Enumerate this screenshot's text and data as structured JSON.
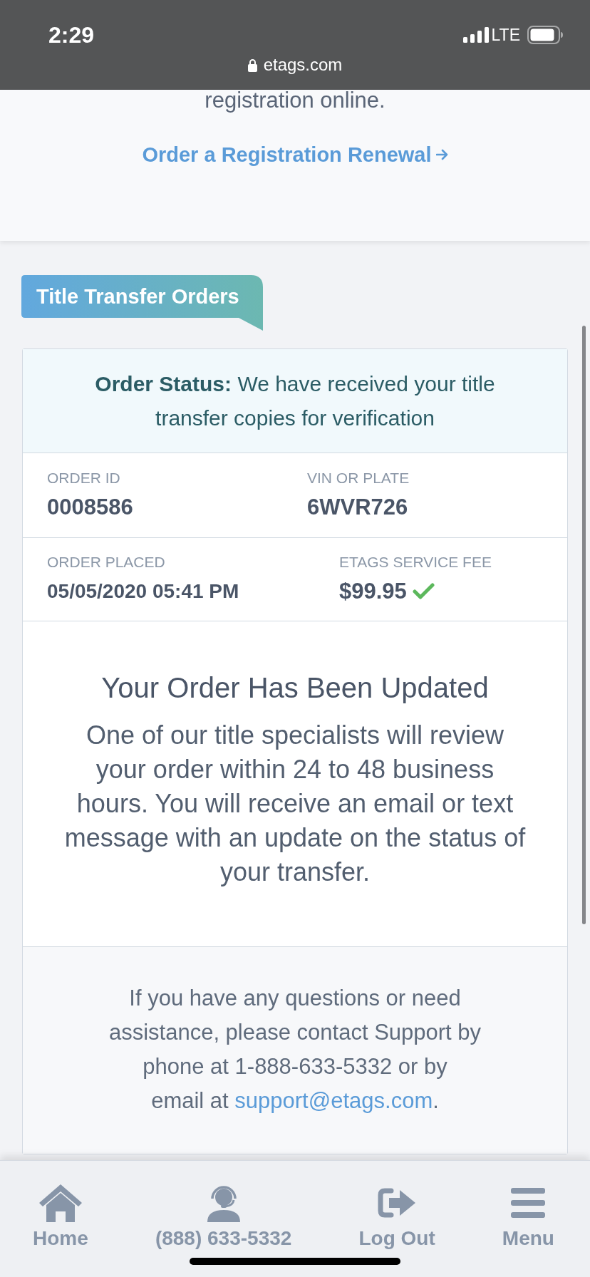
{
  "status_bar": {
    "time": "2:29",
    "network": "LTE"
  },
  "address_bar": {
    "url": "etags.com"
  },
  "intro": {
    "text": "registration online.",
    "link": "Order a Registration Renewal"
  },
  "section_heading": {
    "label": "Title Transfer Orders"
  },
  "order_card": {
    "status": "**Order Status:** We have received your title transfer copies for verification",
    "details": [
      [
        {
          "label": "ORDER ID",
          "value": "0008586",
          "confirmed": false
        },
        {
          "label": "VIN OR PLATE",
          "value": "6WVR726",
          "confirmed": false
        }
      ],
      [
        {
          "label": "ORDER PLACED",
          "value": "05/05/2020 05:41 PM",
          "confirmed": false
        },
        {
          "label": "ETAGS SERVICE FEE",
          "value": "$99.95",
          "confirmed": true
        }
      ]
    ],
    "message": {
      "title": "Your Order Has Been Updated",
      "body": "One of our title specialists will review your order within 24 to 48 business hours. You will receive an email or text message with an update on the status of your transfer."
    },
    "support": {
      "text": "If you have any questions or need assistance, please contact Support by phone at 1-888-633-5332 or by",
      "email_prefix": "email at",
      "email": "support@etags.com",
      "text_after": "."
    }
  },
  "bottom_nav": [
    {
      "kind": "home",
      "label": "Home"
    },
    {
      "kind": "phone",
      "label": "(888) 633-5332"
    },
    {
      "kind": "logout",
      "label": "Log Out"
    },
    {
      "kind": "menu",
      "label": "Menu"
    }
  ]
}
